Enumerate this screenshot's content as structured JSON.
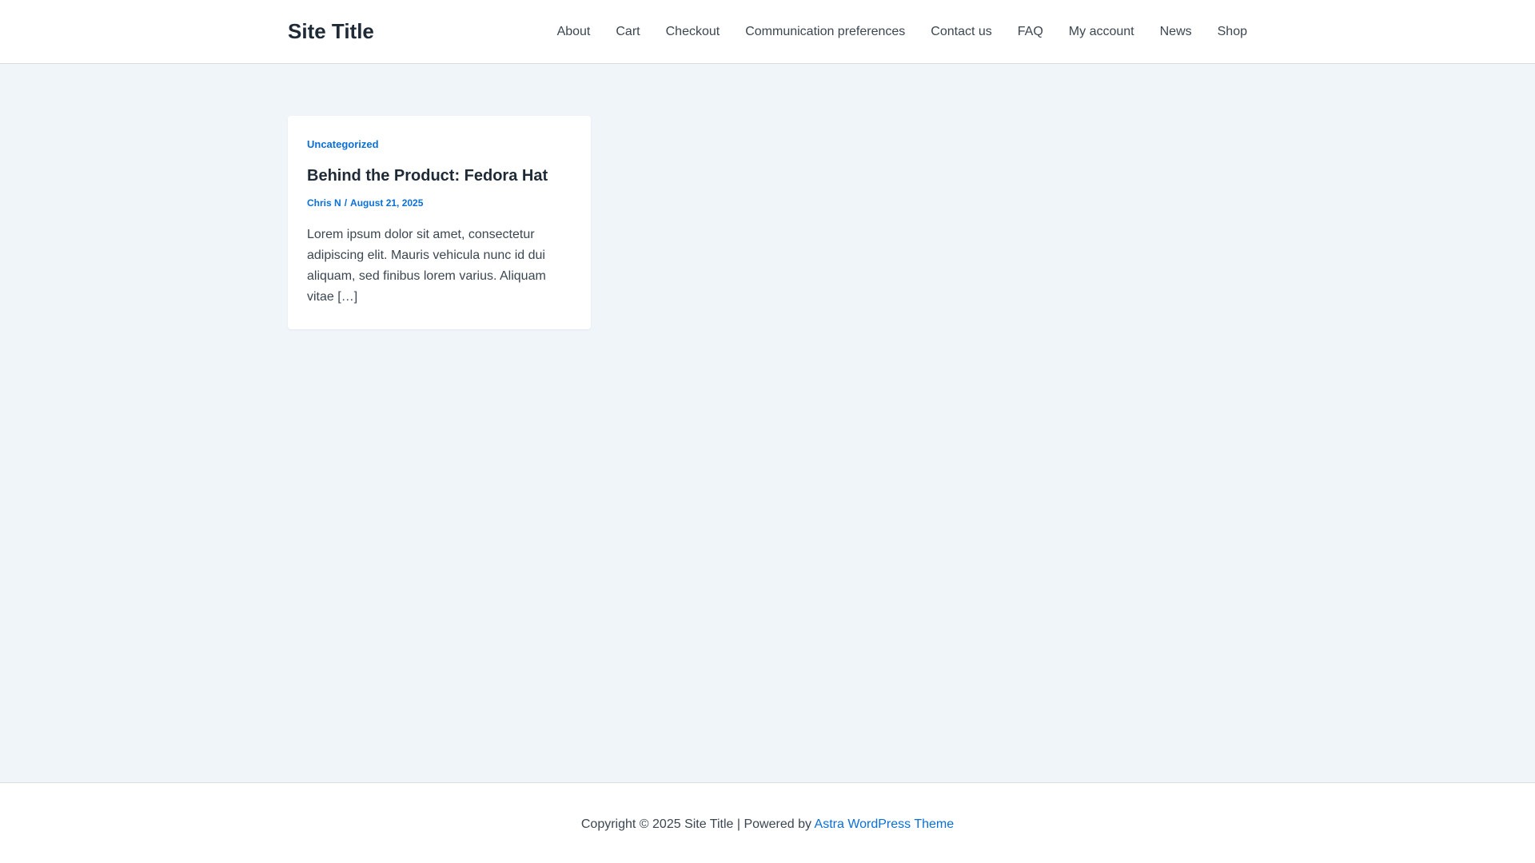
{
  "header": {
    "site_title": "Site Title",
    "nav": {
      "items": [
        {
          "label": "About"
        },
        {
          "label": "Cart"
        },
        {
          "label": "Checkout"
        },
        {
          "label": "Communication preferences"
        },
        {
          "label": "Contact us"
        },
        {
          "label": "FAQ"
        },
        {
          "label": "My account"
        },
        {
          "label": "News"
        },
        {
          "label": "Shop"
        }
      ]
    }
  },
  "main": {
    "post": {
      "category": "Uncategorized",
      "title": "Behind the Product: Fedora Hat",
      "author": "Chris N",
      "separator": "/",
      "date": "August 21, 2025",
      "excerpt": "Lorem ipsum dolor sit amet, consectetur adipiscing elit. Mauris vehicula nunc id dui aliquam, sed finibus lorem varius. Aliquam vitae […]"
    }
  },
  "footer": {
    "copyright": "Copyright © 2025 Site Title | Powered by",
    "theme_link": "Astra WordPress Theme"
  },
  "colors": {
    "background": "#f0f5fa",
    "surface": "#ffffff",
    "accent": "#0a6fd8",
    "heading": "#1f2a37",
    "text": "#3b4651"
  }
}
